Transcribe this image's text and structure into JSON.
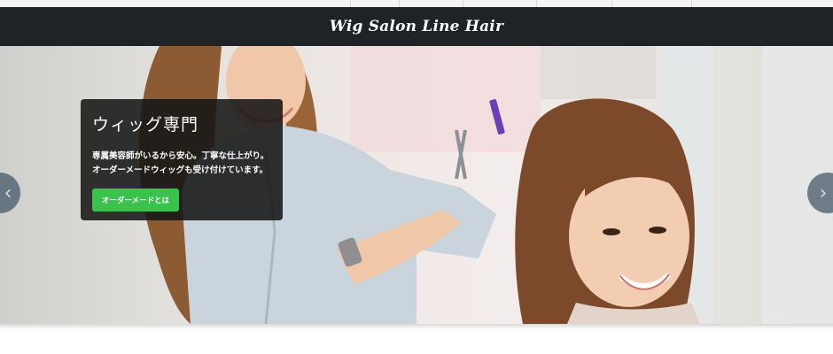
{
  "header": {
    "logo": "Wig Salon Line Hair"
  },
  "slider": {
    "caption": {
      "title": "ウィッグ専門",
      "text": "専属美容師がいるから安心。丁寧な仕上がり。オーダーメードウィッグも受け付けています。",
      "button_label": "オーダーメードとは"
    },
    "prev_icon": "chevron-left-icon",
    "next_icon": "chevron-right-icon",
    "arrow_color": "#465868",
    "button_color": "#39c34b"
  },
  "colors": {
    "header_bg": "#1f2326"
  }
}
